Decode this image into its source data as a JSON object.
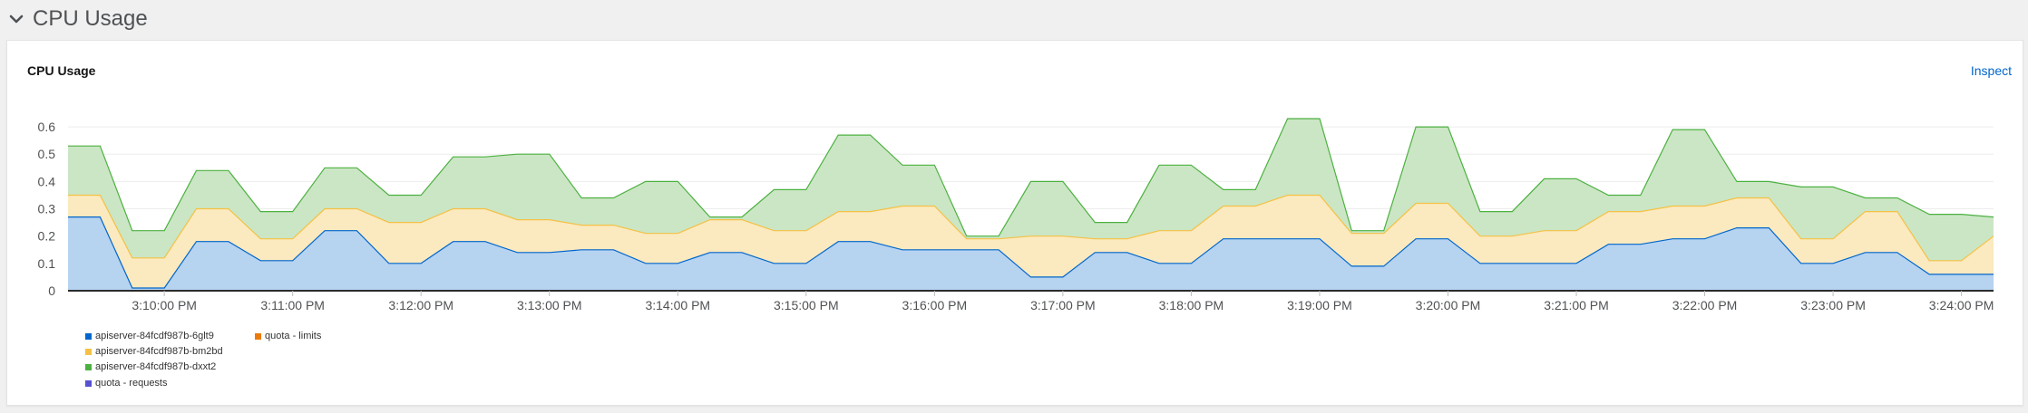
{
  "section": {
    "title": "CPU Usage"
  },
  "card": {
    "title": "CPU Usage",
    "inspect_label": "Inspect"
  },
  "colors": {
    "blue": "#06c",
    "blue_fill": "#b6d3f0",
    "gold": "#f4c145",
    "gold_fill": "#fbe9bf",
    "green": "#4cb140",
    "green_fill": "#cbe6c5",
    "orange": "#ec7a08",
    "purple": "#5752d1"
  },
  "legend": [
    {
      "name": "apiserver-84fcdf987b-6glt9",
      "color": "#06c"
    },
    {
      "name": "quota - limits",
      "color": "#ec7a08"
    },
    {
      "name": "apiserver-84fcdf987b-bm2bd",
      "color": "#f4c145"
    },
    {
      "name": "apiserver-84fcdf987b-dxxt2",
      "color": "#4cb140"
    },
    {
      "name": "quota - requests",
      "color": "#5752d1"
    }
  ],
  "chart_data": {
    "type": "area",
    "stacked": true,
    "ylim": [
      0,
      0.65
    ],
    "y_ticks": [
      "0",
      "0.1",
      "0.2",
      "0.3",
      "0.4",
      "0.5",
      "0.6"
    ],
    "y_tick_values": [
      0,
      0.1,
      0.2,
      0.3,
      0.4,
      0.5,
      0.6
    ],
    "x_tick_labels": [
      "3:10:00 PM",
      "3:11:00 PM",
      "3:12:00 PM",
      "3:13:00 PM",
      "3:14:00 PM",
      "3:15:00 PM",
      "3:16:00 PM",
      "3:17:00 PM",
      "3:18:00 PM",
      "3:19:00 PM",
      "3:20:00 PM",
      "3:21:00 PM",
      "3:22:00 PM",
      "3:23:00 PM",
      "3:24:00 PM"
    ],
    "x_tick_times": [
      "3:10:00 PM",
      "3:11:00 PM",
      "3:12:00 PM",
      "3:13:00 PM",
      "3:14:00 PM",
      "3:15:00 PM",
      "3:16:00 PM",
      "3:17:00 PM",
      "3:18:00 PM",
      "3:19:00 PM",
      "3:20:00 PM",
      "3:21:00 PM",
      "3:22:00 PM",
      "3:23:00 PM",
      "3:24:00 PM"
    ],
    "x": [
      "3:09:15 PM",
      "3:09:30 PM",
      "3:09:45 PM",
      "3:10:00 PM",
      "3:10:15 PM",
      "3:10:30 PM",
      "3:10:45 PM",
      "3:11:00 PM",
      "3:11:15 PM",
      "3:11:30 PM",
      "3:11:45 PM",
      "3:12:00 PM",
      "3:12:15 PM",
      "3:12:30 PM",
      "3:12:45 PM",
      "3:13:00 PM",
      "3:13:15 PM",
      "3:13:30 PM",
      "3:13:45 PM",
      "3:14:00 PM",
      "3:14:15 PM",
      "3:14:30 PM",
      "3:14:45 PM",
      "3:15:00 PM",
      "3:15:15 PM",
      "3:15:30 PM",
      "3:15:45 PM",
      "3:16:00 PM",
      "3:16:15 PM",
      "3:16:30 PM",
      "3:16:45 PM",
      "3:17:00 PM",
      "3:17:15 PM",
      "3:17:30 PM",
      "3:17:45 PM",
      "3:18:00 PM",
      "3:18:15 PM",
      "3:18:30 PM",
      "3:18:45 PM",
      "3:19:00 PM",
      "3:19:15 PM",
      "3:19:30 PM",
      "3:19:45 PM",
      "3:20:00 PM",
      "3:20:15 PM",
      "3:20:30 PM",
      "3:20:45 PM",
      "3:21:00 PM",
      "3:21:15 PM",
      "3:21:30 PM",
      "3:21:45 PM",
      "3:22:00 PM",
      "3:22:15 PM",
      "3:22:30 PM",
      "3:22:45 PM",
      "3:23:00 PM",
      "3:23:15 PM",
      "3:23:30 PM",
      "3:23:45 PM",
      "3:24:00 PM",
      "3:24:15 PM"
    ],
    "series": [
      {
        "name": "apiserver-84fcdf987b-6glt9",
        "color": "#06c",
        "fill": "#b6d3f0",
        "values": [
          0.27,
          0.27,
          0.01,
          0.01,
          0.18,
          0.18,
          0.11,
          0.11,
          0.22,
          0.22,
          0.1,
          0.1,
          0.18,
          0.18,
          0.14,
          0.14,
          0.15,
          0.15,
          0.1,
          0.1,
          0.14,
          0.14,
          0.1,
          0.1,
          0.18,
          0.18,
          0.15,
          0.15,
          0.15,
          0.15,
          0.05,
          0.05,
          0.14,
          0.14,
          0.1,
          0.1,
          0.19,
          0.19,
          0.19,
          0.19,
          0.09,
          0.09,
          0.19,
          0.19,
          0.1,
          0.1,
          0.1,
          0.1,
          0.17,
          0.17,
          0.19,
          0.19,
          0.23,
          0.23,
          0.1,
          0.1,
          0.14,
          0.14,
          0.06,
          0.06,
          0.06
        ]
      },
      {
        "name": "apiserver-84fcdf987b-bm2bd",
        "color": "#f4c145",
        "fill": "#fbe9bf",
        "values": [
          0.08,
          0.08,
          0.11,
          0.11,
          0.12,
          0.12,
          0.08,
          0.08,
          0.08,
          0.08,
          0.15,
          0.15,
          0.12,
          0.12,
          0.12,
          0.12,
          0.09,
          0.09,
          0.11,
          0.11,
          0.12,
          0.12,
          0.12,
          0.12,
          0.11,
          0.11,
          0.16,
          0.16,
          0.04,
          0.04,
          0.15,
          0.15,
          0.05,
          0.05,
          0.12,
          0.12,
          0.12,
          0.12,
          0.16,
          0.16,
          0.12,
          0.12,
          0.13,
          0.13,
          0.1,
          0.1,
          0.12,
          0.12,
          0.12,
          0.12,
          0.12,
          0.12,
          0.11,
          0.11,
          0.09,
          0.09,
          0.15,
          0.15,
          0.05,
          0.05,
          0.14
        ]
      },
      {
        "name": "apiserver-84fcdf987b-dxxt2",
        "color": "#4cb140",
        "fill": "#cbe6c5",
        "values": [
          0.18,
          0.18,
          0.1,
          0.1,
          0.14,
          0.14,
          0.1,
          0.1,
          0.15,
          0.15,
          0.1,
          0.1,
          0.19,
          0.19,
          0.24,
          0.24,
          0.1,
          0.1,
          0.19,
          0.19,
          0.01,
          0.01,
          0.15,
          0.15,
          0.28,
          0.28,
          0.15,
          0.15,
          0.01,
          0.01,
          0.2,
          0.2,
          0.06,
          0.06,
          0.24,
          0.24,
          0.06,
          0.06,
          0.28,
          0.28,
          0.01,
          0.01,
          0.28,
          0.28,
          0.09,
          0.09,
          0.19,
          0.19,
          0.06,
          0.06,
          0.28,
          0.28,
          0.06,
          0.06,
          0.19,
          0.19,
          0.05,
          0.05,
          0.17,
          0.17,
          0.07
        ]
      }
    ]
  }
}
